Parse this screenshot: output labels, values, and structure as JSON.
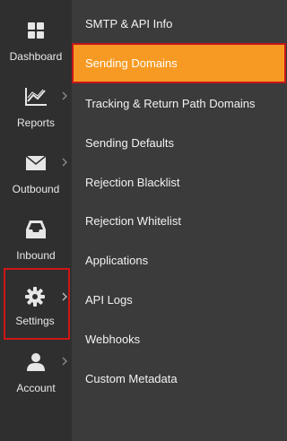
{
  "rail": {
    "items": [
      {
        "label": "Dashboard",
        "icon": "dashboard-icon",
        "has_submenu": false
      },
      {
        "label": "Reports",
        "icon": "reports-icon",
        "has_submenu": true
      },
      {
        "label": "Outbound",
        "icon": "envelope-icon",
        "has_submenu": true
      },
      {
        "label": "Inbound",
        "icon": "inbox-icon",
        "has_submenu": false
      },
      {
        "label": "Settings",
        "icon": "gear-icon",
        "has_submenu": true,
        "active": true
      },
      {
        "label": "Account",
        "icon": "user-icon",
        "has_submenu": true
      }
    ]
  },
  "submenu": {
    "items": [
      {
        "label": "SMTP & API Info"
      },
      {
        "label": "Sending Domains",
        "selected": true
      },
      {
        "label": "Tracking & Return Path Domains"
      },
      {
        "label": "Sending Defaults"
      },
      {
        "label": "Rejection Blacklist"
      },
      {
        "label": "Rejection Whitelist"
      },
      {
        "label": "Applications"
      },
      {
        "label": "API Logs"
      },
      {
        "label": "Webhooks"
      },
      {
        "label": "Custom Metadata"
      }
    ]
  },
  "colors": {
    "accent": "#f79a23",
    "highlight_border": "#c4161c",
    "rail_bg": "#2f2f2f",
    "submenu_bg": "#3b3b3b"
  }
}
